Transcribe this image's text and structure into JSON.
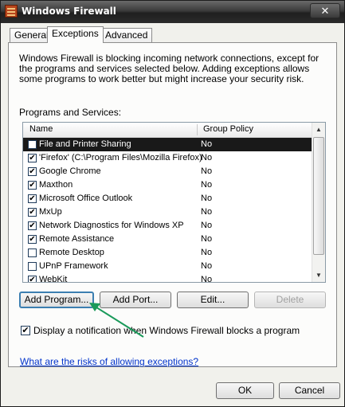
{
  "window": {
    "title": "Windows Firewall",
    "close_glyph": "✕",
    "icon": "firewall-icon"
  },
  "tabs": [
    {
      "label": "General",
      "active": false
    },
    {
      "label": "Exceptions",
      "active": true
    },
    {
      "label": "Advanced",
      "active": false
    }
  ],
  "description": "Windows Firewall is blocking incoming network connections, except for the programs and services selected below. Adding exceptions allows some programs to work better but might increase your security risk.",
  "programs_label": "Programs and Services:",
  "list": {
    "columns": [
      "Name",
      "Group Policy"
    ],
    "rows": [
      {
        "name": "File and Printer Sharing",
        "group_policy": "No",
        "checked": false,
        "selected": true
      },
      {
        "name": "'Firefox' (C:\\Program Files\\Mozilla Firefox)",
        "group_policy": "No",
        "checked": true,
        "selected": false
      },
      {
        "name": "Google Chrome",
        "group_policy": "No",
        "checked": true,
        "selected": false
      },
      {
        "name": "Maxthon",
        "group_policy": "No",
        "checked": true,
        "selected": false
      },
      {
        "name": "Microsoft Office Outlook",
        "group_policy": "No",
        "checked": true,
        "selected": false
      },
      {
        "name": "MxUp",
        "group_policy": "No",
        "checked": true,
        "selected": false
      },
      {
        "name": "Network Diagnostics for Windows XP",
        "group_policy": "No",
        "checked": true,
        "selected": false
      },
      {
        "name": "Remote Assistance",
        "group_policy": "No",
        "checked": true,
        "selected": false
      },
      {
        "name": "Remote Desktop",
        "group_policy": "No",
        "checked": false,
        "selected": false
      },
      {
        "name": "UPnP Framework",
        "group_policy": "No",
        "checked": false,
        "selected": false
      },
      {
        "name": "WebKit",
        "group_policy": "No",
        "checked": true,
        "selected": false
      }
    ]
  },
  "buttons": {
    "add_program": "Add Program...",
    "add_port": "Add Port...",
    "edit": "Edit...",
    "delete": "Delete"
  },
  "notification": {
    "label": "Display a notification when Windows Firewall blocks a program",
    "checked": true
  },
  "risk_link": "What are the risks of allowing exceptions?",
  "footer": {
    "ok": "OK",
    "cancel": "Cancel"
  },
  "annotation": {
    "arrow_color": "#1a9a5a"
  },
  "glyphs": {
    "check": "✔",
    "scroll_up": "▲",
    "scroll_down": "▼"
  }
}
